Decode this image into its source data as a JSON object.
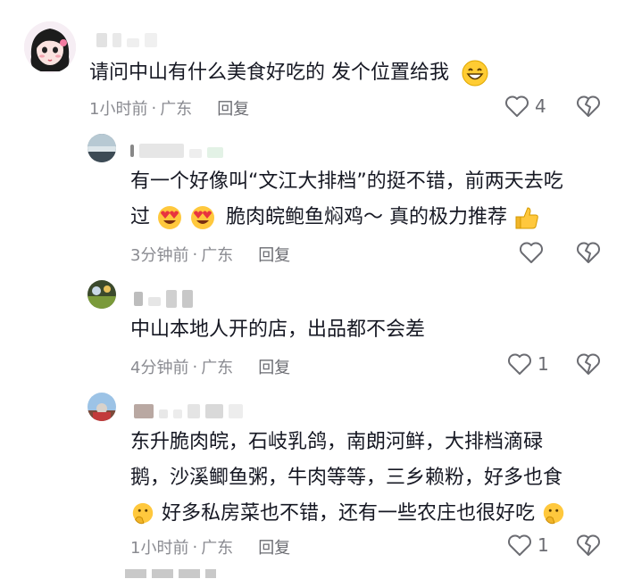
{
  "comments": [
    {
      "text_lines": [
        "请问中山有什么美食好吃的  发个位置给我"
      ],
      "time": "1小时前",
      "region": "广东",
      "reply_label": "回复",
      "like_count": "4"
    },
    {
      "text_lines": [
        "有一个好像叫“文江大排档”的挺不错，前两天去吃",
        "过",
        "脆肉皖鲍鱼焖鸡～ 真的极力推荐"
      ],
      "time": "3分钟前",
      "region": "广东",
      "reply_label": "回复",
      "like_count": ""
    },
    {
      "text_lines": [
        "中山本地人开的店，出品都不会差"
      ],
      "time": "4分钟前",
      "region": "广东",
      "reply_label": "回复",
      "like_count": "1"
    },
    {
      "text_lines": [
        "东升脆肉皖，石岐乳鸽，南朗河鲜，大排档滴碌",
        "鹅，沙溪鲫鱼粥，牛肉等等，三乡赖粉，好多也食",
        "好多私房菜也不错，还有一些农庄也很好吃"
      ],
      "time": "1小时前",
      "region": "广东",
      "reply_label": "回复",
      "like_count": "1"
    }
  ],
  "meta_separator": "·",
  "icons": {
    "like": "heart-outline-icon",
    "dislike": "broken-heart-icon",
    "grin": "grinning-emoji-icon",
    "heart_eyes": "heart-eyes-emoji-icon",
    "thumbs_up": "thumbs-up-emoji-icon",
    "thinking": "shushing-emoji-icon"
  },
  "colors": {
    "text": "#161823",
    "meta": "#8a8b91",
    "icon": "#6b6c72"
  }
}
